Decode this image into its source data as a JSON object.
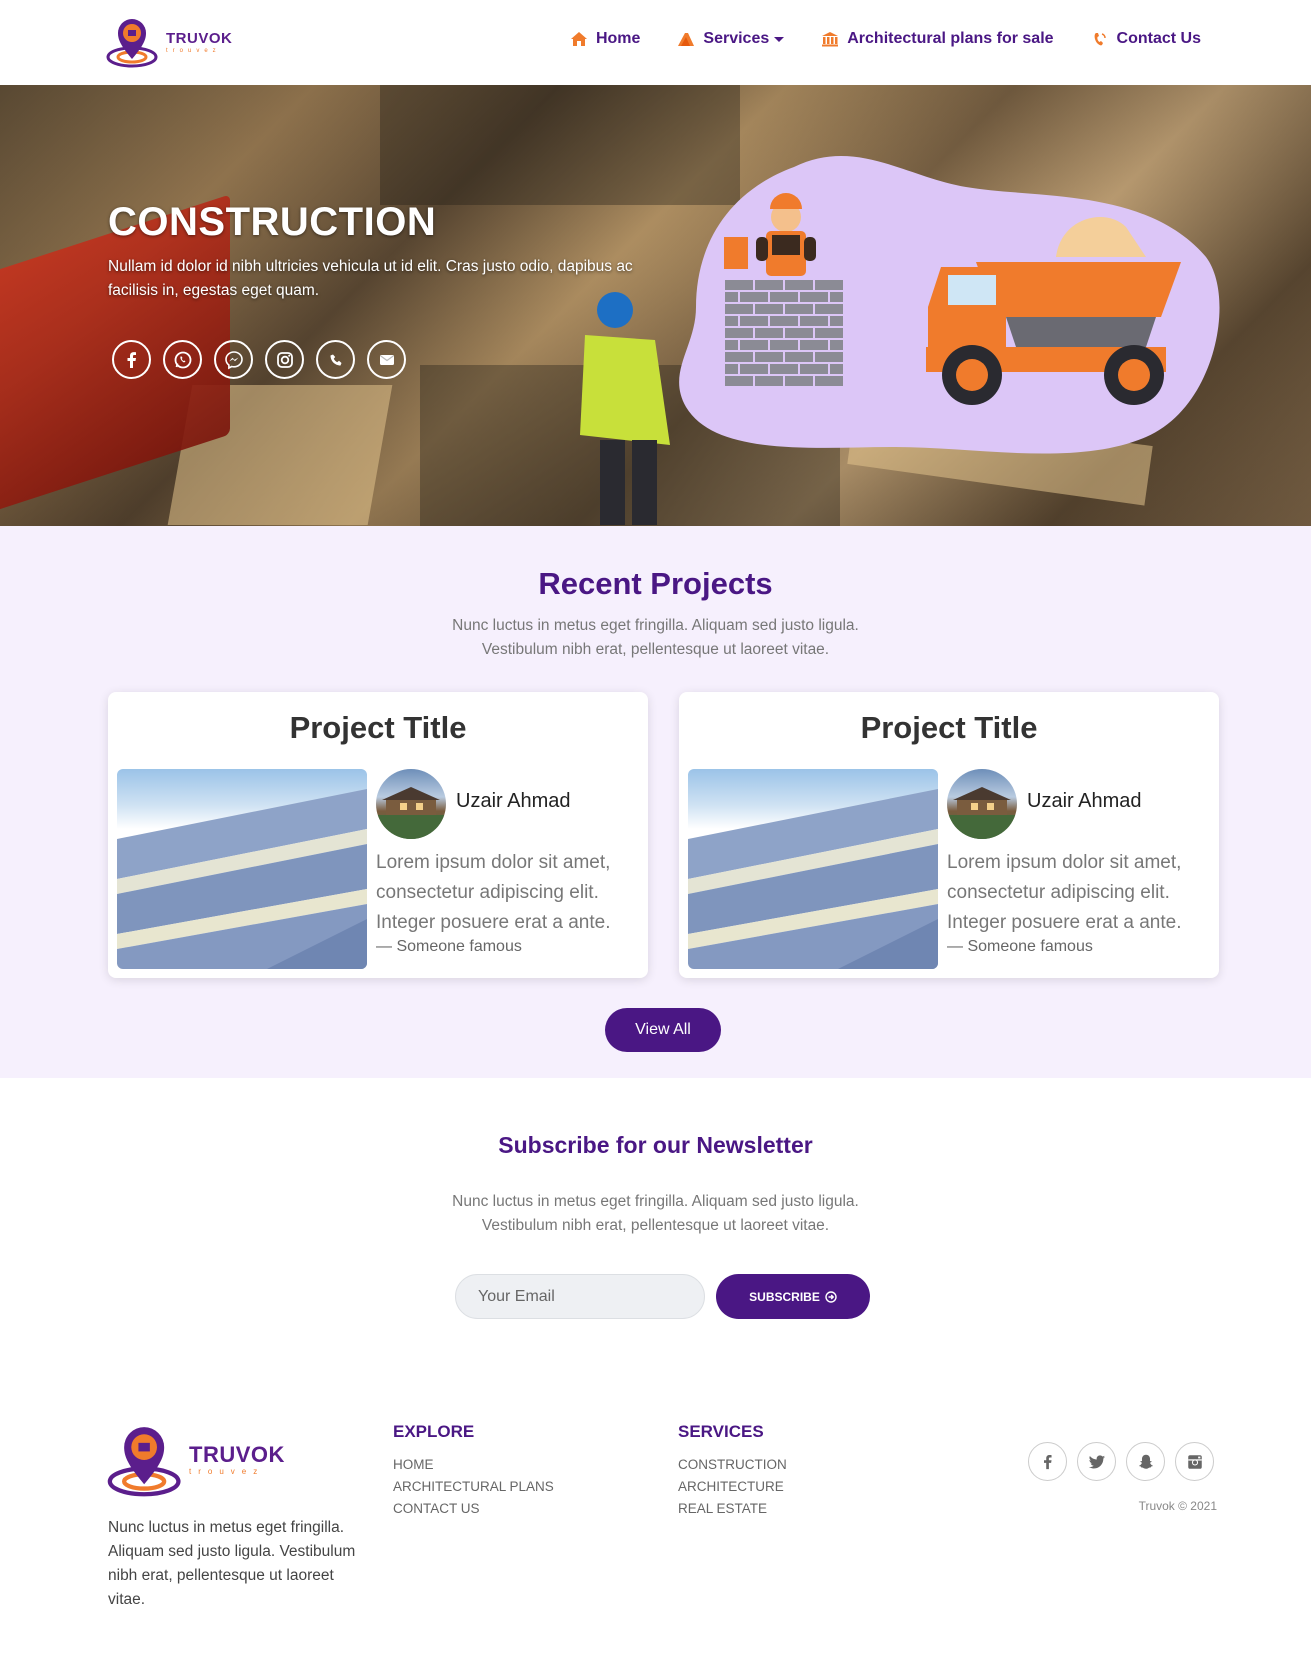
{
  "brand": {
    "name": "TRUVOK",
    "tagline": "trouvez"
  },
  "nav": {
    "items": [
      {
        "label": "Home",
        "icon": "home-icon"
      },
      {
        "label": "Services",
        "icon": "services-icon",
        "dropdown": true
      },
      {
        "label": "Architectural plans for sale",
        "icon": "bank-icon"
      },
      {
        "label": "Contact Us",
        "icon": "phone-icon"
      }
    ]
  },
  "hero": {
    "title": "CONSTRUCTION",
    "text": "Nullam id dolor id nibh ultricies vehicula ut id elit. Cras justo odio, dapibus ac facilisis in, egestas eget quam.",
    "social": [
      "facebook-icon",
      "whatsapp-icon",
      "messenger-icon",
      "instagram-icon",
      "phone-icon",
      "email-icon"
    ]
  },
  "projects": {
    "title": "Recent Projects",
    "subtitle_line1": "Nunc luctus in metus eget fringilla. Aliquam sed justo ligula.",
    "subtitle_line2": "Vestibulum nibh erat, pellentesque ut laoreet vitae.",
    "cards": [
      {
        "title": "Project Title",
        "author": "Uzair Ahmad",
        "quote": "Lorem ipsum dolor sit amet, consectetur adipiscing elit. Integer posuere erat a ante.",
        "cite": "— Someone famous"
      },
      {
        "title": "Project Title",
        "author": "Uzair Ahmad",
        "quote": "Lorem ipsum dolor sit amet, consectetur adipiscing elit. Integer posuere erat a ante.",
        "cite": "— Someone famous"
      }
    ],
    "view_all": "View All"
  },
  "newsletter": {
    "title": "Subscribe for our Newsletter",
    "subtitle_line1": "Nunc luctus in metus eget fringilla. Aliquam sed justo ligula.",
    "subtitle_line2": "Vestibulum nibh erat, pellentesque ut laoreet vitae.",
    "email_placeholder": "Your Email",
    "subscribe_label": "SUBSCRIBE"
  },
  "footer": {
    "about": "Nunc luctus in metus eget fringilla. Aliquam sed justo ligula. Vestibulum nibh erat, pellentesque ut laoreet vitae.",
    "explore": {
      "heading": "EXPLORE",
      "links": [
        "HOME",
        "ARCHITECTURAL PLANS",
        "CONTACT US"
      ]
    },
    "services": {
      "heading": "SERVICES",
      "links": [
        "CONSTRUCTION",
        "ARCHITECTURE",
        "REAL ESTATE"
      ]
    },
    "social": [
      "facebook-icon",
      "twitter-icon",
      "snapchat-icon",
      "instagram-icon"
    ],
    "copyright": "Truvok © 2021"
  },
  "colors": {
    "primary": "#4a1784",
    "accent": "#f07b2c",
    "section_bg": "#f6f0fd",
    "blob": "#dcc6f7"
  }
}
